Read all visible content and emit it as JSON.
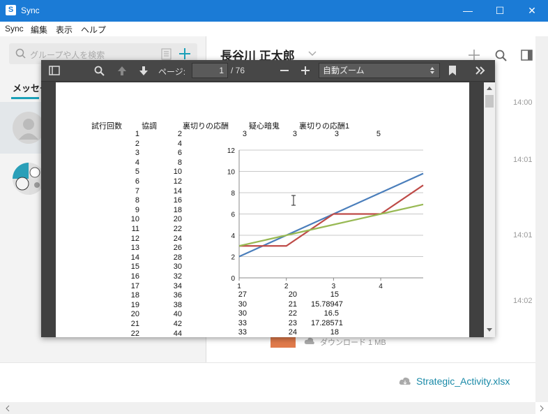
{
  "window": {
    "title": "Sync",
    "app_icon": "S",
    "min": "—",
    "max": "☐",
    "close": "✕"
  },
  "menu": [
    "Sync",
    "編集",
    "表示",
    "ヘルプ"
  ],
  "sidebar": {
    "search_placeholder": "グループや人を検索",
    "tab_label": "メッセー"
  },
  "chat": {
    "contact_name": "長谷川 正太郎",
    "times": [
      "14:00",
      "14:01",
      "14:01",
      "14:02"
    ],
    "download_label": "ダウンロード 1 MB"
  },
  "footer": {
    "file_name": "Strategic_Activity.xlsx"
  },
  "pdf": {
    "page_label": "ページ:",
    "page_value": "1",
    "page_total": "/ 76",
    "zoom": "自動ズーム"
  },
  "sheet": {
    "headers": [
      "試行回数",
      "協調",
      "裏切りの応酬",
      "疑心暗鬼",
      "裏切りの応酬1"
    ],
    "row0_extra": [
      "3",
      "3",
      "3",
      "5"
    ],
    "col_trials": [
      "1",
      "2",
      "3",
      "4",
      "5",
      "6",
      "7",
      "8",
      "9",
      "10",
      "11",
      "12",
      "13",
      "14",
      "15",
      "16",
      "17",
      "18",
      "19",
      "20",
      "21",
      "22"
    ],
    "col_coop": [
      "2",
      "4",
      "6",
      "8",
      "10",
      "12",
      "14",
      "16",
      "18",
      "20",
      "22",
      "24",
      "26",
      "28",
      "30",
      "32",
      "34",
      "36",
      "38",
      "40",
      "42",
      "44"
    ],
    "tail_rows": [
      [
        "27",
        "20",
        "15"
      ],
      [
        "30",
        "21",
        "15.78947"
      ],
      [
        "30",
        "22",
        "16.5"
      ],
      [
        "33",
        "23",
        "17.28571"
      ],
      [
        "33",
        "24",
        "18"
      ]
    ]
  },
  "chart_data": {
    "type": "line",
    "x": [
      1,
      2,
      3,
      4
    ],
    "ylim": [
      0,
      12
    ],
    "xlim": [
      1,
      4.9
    ],
    "yticks": [
      "0",
      "2",
      "4",
      "6",
      "8",
      "10",
      "12"
    ],
    "xticks": [
      "1",
      "2",
      "3",
      "4"
    ],
    "grid": true,
    "series": [
      {
        "color": "#4a7ebb",
        "points": [
          [
            1,
            2
          ],
          [
            2,
            4
          ],
          [
            3,
            6
          ],
          [
            4,
            8
          ],
          [
            4.9,
            9.8
          ]
        ]
      },
      {
        "color": "#be4b48",
        "points": [
          [
            1,
            3
          ],
          [
            2,
            3
          ],
          [
            3,
            6
          ],
          [
            4,
            6
          ],
          [
            4.9,
            8.7
          ]
        ]
      },
      {
        "color": "#98b954",
        "points": [
          [
            1,
            3
          ],
          [
            2,
            4
          ],
          [
            3,
            5
          ],
          [
            4,
            6
          ],
          [
            4.9,
            6.9
          ]
        ]
      }
    ]
  }
}
